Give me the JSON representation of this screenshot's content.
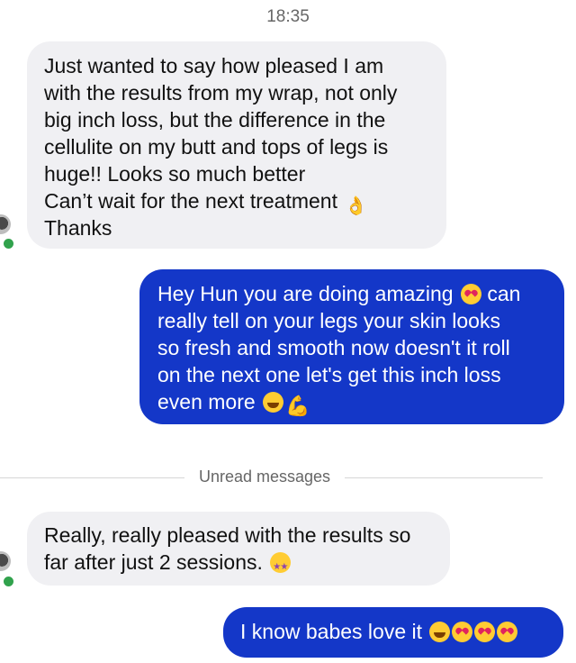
{
  "header": {
    "time": "18:35"
  },
  "messages": [
    {
      "direction": "incoming",
      "text": "Just wanted to say how pleased I am\nwith the results from my wrap, not only\nbig inch loss, but the difference in the\ncellulite on my butt and tops of legs is\nhuge!! Looks so much better\nCan’t wait for the next treatment",
      "text_after": "\nThanks",
      "emojis": [
        "ok-hand-emoji"
      ]
    },
    {
      "direction": "outgoing",
      "text": "Hey Hun you are doing amazing",
      "text_mid": " can\nreally tell on your legs  your skin looks\nso fresh and smooth now doesn't it roll\non the next one let's get this inch loss\neven more ",
      "emojis": [
        "heart-eyes-emoji",
        "laughing-emoji",
        "flexed-biceps-emoji"
      ]
    },
    {
      "direction": "incoming",
      "text": "Really, really pleased with the results so\nfar after just 2 sessions. ",
      "emojis": [
        "star-struck-emoji"
      ]
    },
    {
      "direction": "outgoing",
      "text": "I know babes love it ",
      "emojis": [
        "laughing-emoji",
        "heart-eyes-emoji",
        "heart-eyes-emoji",
        "heart-eyes-emoji"
      ]
    }
  ],
  "divider": {
    "label": "Unread messages"
  },
  "colors": {
    "outgoing_bubble": "#1437c8",
    "incoming_bubble": "#f0f0f3",
    "online_dot": "#31a24c"
  }
}
